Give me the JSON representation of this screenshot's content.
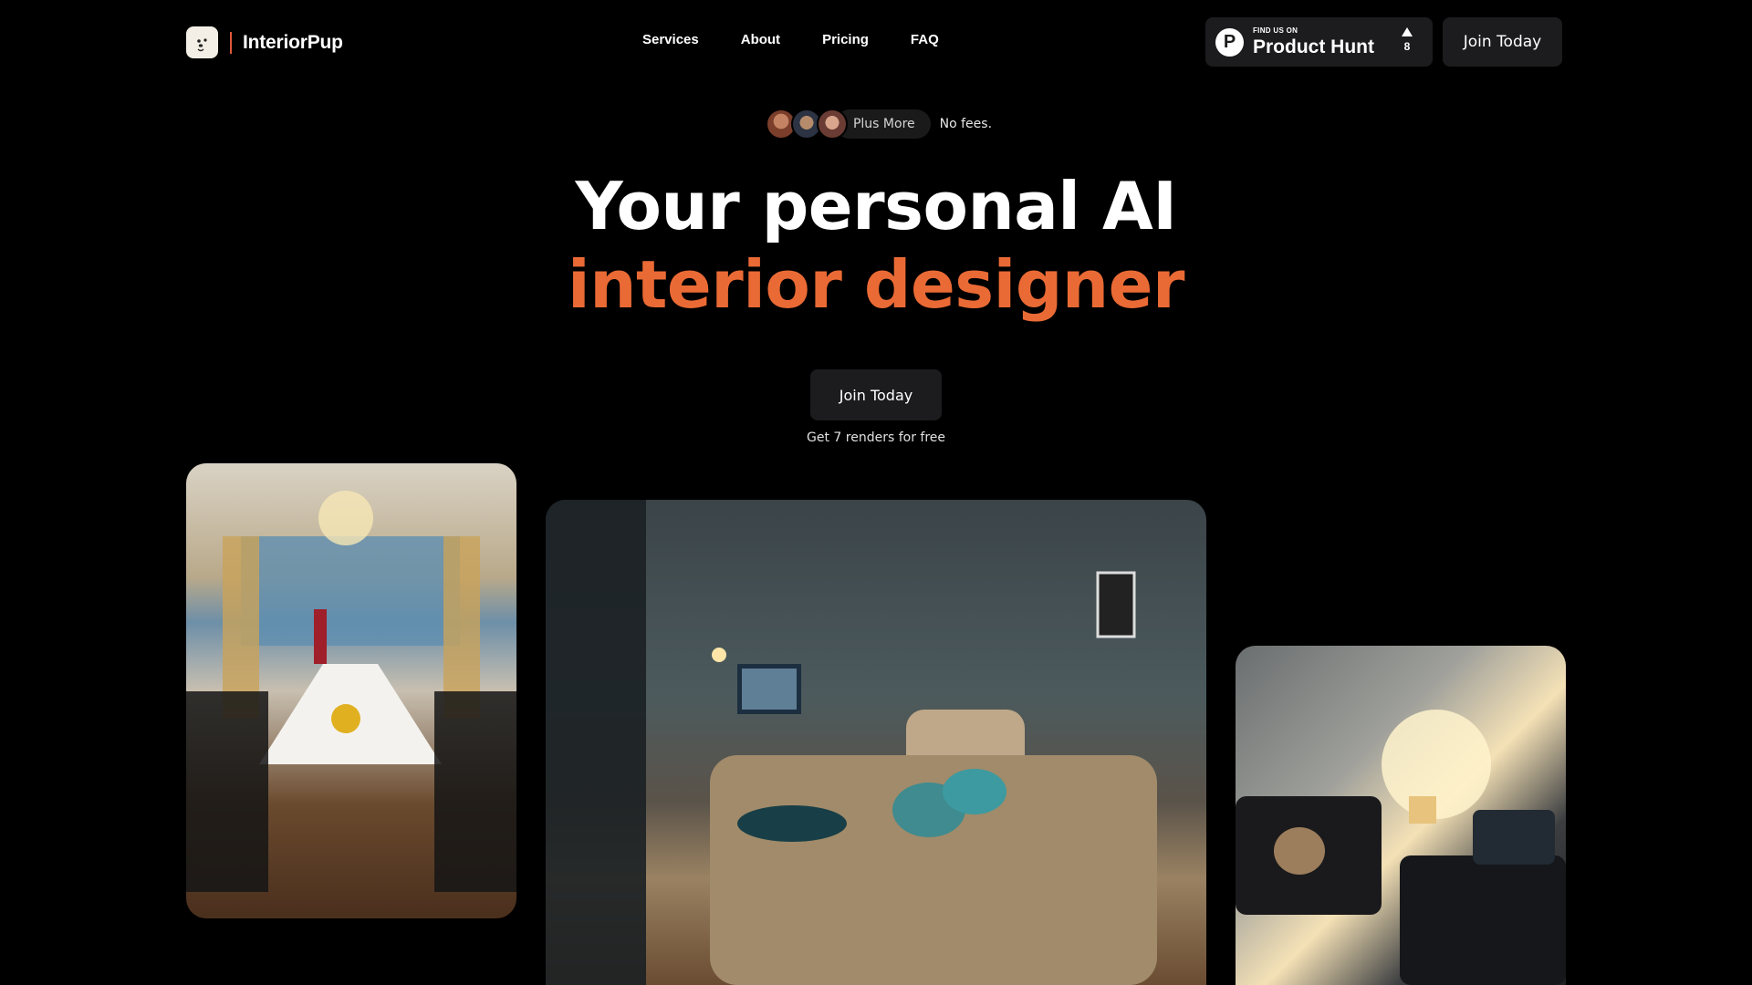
{
  "header": {
    "brand": "InteriorPup",
    "nav": [
      "Services",
      "About",
      "Pricing",
      "FAQ"
    ],
    "product_hunt": {
      "small_label": "FIND US ON",
      "big_label": "Product Hunt",
      "letter": "P",
      "votes": "8"
    },
    "join_label": "Join Today"
  },
  "hero": {
    "plus_more": "Plus More",
    "no_fees": "No fees.",
    "title_line1": "Your personal AI",
    "title_line2": "interior designer",
    "accent_color": "#ea6a35",
    "cta_label": "Join Today",
    "cta_note": "Get 7 renders for free"
  },
  "gallery": [
    {
      "name": "dining-room-render"
    },
    {
      "name": "bedroom-render"
    },
    {
      "name": "living-room-render"
    }
  ]
}
